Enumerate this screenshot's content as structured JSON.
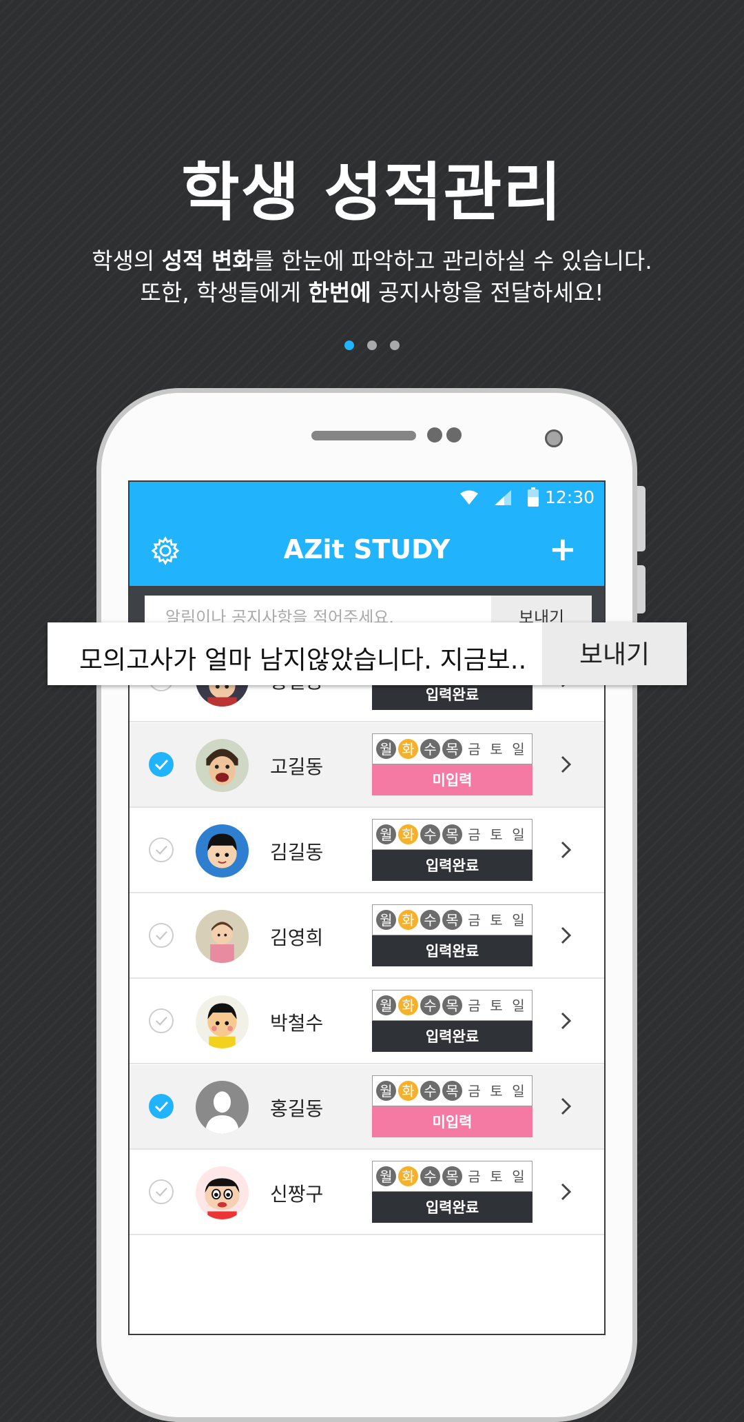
{
  "headline": "학생 성적관리",
  "description": {
    "line1": {
      "before": "학생의 ",
      "bold": "성적 변화",
      "after": "를 한눈에 파악하고 관리하실 수 있습니다."
    },
    "line2": {
      "before": "또한, 학생들에게 ",
      "bold": "한번에",
      "after": " 공지사항을 전달하세요!"
    }
  },
  "pagination": {
    "count": 3,
    "active_index": 0
  },
  "status_bar": {
    "time": "12:30"
  },
  "app_bar": {
    "title": "AZit STUDY",
    "settings_icon": "gear-icon",
    "add_icon": "plus-icon",
    "add_label": "+"
  },
  "compose": {
    "placeholder": "알림이나 공지사항을 적어주세요.",
    "send_label": "보내기"
  },
  "popup": {
    "text": "모의고사가 얼마 남지않았습니다. 지금보..",
    "send_label": "보내기"
  },
  "week_days": [
    "월",
    "화",
    "수",
    "목",
    "금",
    "토",
    "일"
  ],
  "status_labels": {
    "done": "입력완료",
    "todo": "미입력"
  },
  "students": [
    {
      "name": "홍길동",
      "checked": false,
      "status": "입력완료",
      "avatar": "cartoon-boy-helmet"
    },
    {
      "name": "고길동",
      "checked": true,
      "status": "미입력",
      "avatar": "cartoon-man-crying"
    },
    {
      "name": "김길동",
      "checked": false,
      "status": "입력완료",
      "avatar": "cartoon-boy-blue-bg"
    },
    {
      "name": "김영희",
      "checked": false,
      "status": "입력완료",
      "avatar": "cartoon-girl"
    },
    {
      "name": "박철수",
      "checked": false,
      "status": "입력완료",
      "avatar": "cartoon-boy-yellow"
    },
    {
      "name": "홍길동",
      "checked": true,
      "status": "미입력",
      "avatar": "default-person-silhouette"
    },
    {
      "name": "신짱구",
      "checked": false,
      "status": "입력완료",
      "avatar": "cartoon-shinchan"
    }
  ],
  "colors": {
    "accent": "#21b3fb",
    "done_badge": "#2f3337",
    "todo_badge": "#f47aa4",
    "highlight_day": "#f5b12d",
    "marked_day": "#6c6c6c"
  }
}
